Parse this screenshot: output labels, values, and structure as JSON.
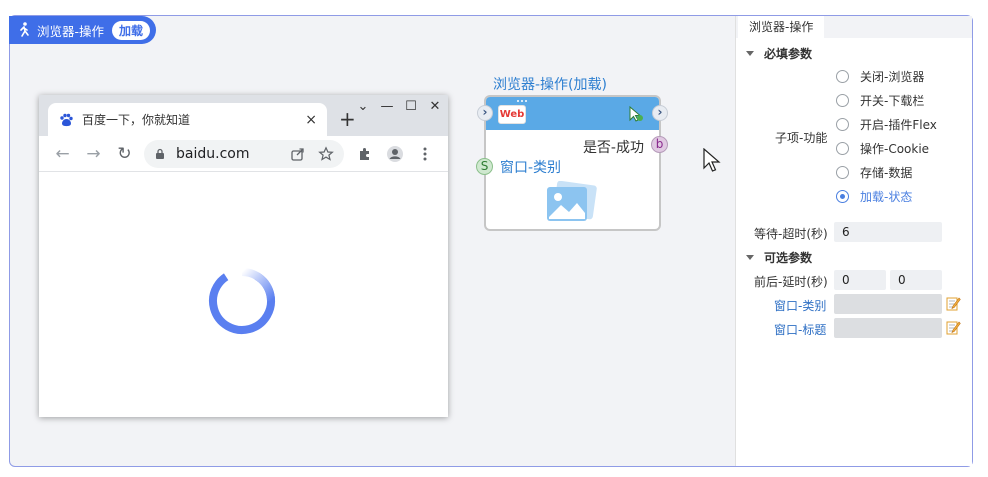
{
  "header": {
    "title": "浏览器-操作",
    "badge": "加载"
  },
  "browser": {
    "tab_title": "百度一下，你就知道",
    "tab_close": "×",
    "new_tab": "+",
    "url": "baidu.com",
    "win_controls": [
      "⌄",
      "—",
      "☐",
      "✕"
    ]
  },
  "node": {
    "title": "浏览器-操作(加载)",
    "web_icon_label": "Web",
    "output_label": "是否-成功",
    "output_port": "b",
    "input_port": "S",
    "input_label": "窗口-类别"
  },
  "panel": {
    "tab": "浏览器-操作",
    "required_section": "必填参数",
    "sub_function_label": "子项-功能",
    "options": [
      {
        "label": "关闭-浏览器",
        "selected": false
      },
      {
        "label": "开关-下载栏",
        "selected": false
      },
      {
        "label": "开启-插件Flex",
        "selected": false
      },
      {
        "label": "操作-Cookie",
        "selected": false
      },
      {
        "label": "存储-数据",
        "selected": false
      },
      {
        "label": "加载-状态",
        "selected": true
      }
    ],
    "timeout_label": "等待-超时(秒)",
    "timeout_value": "6",
    "optional_section": "可选参数",
    "delay_label": "前后-延时(秒)",
    "delay_before": "0",
    "delay_after": "0",
    "window_type_label": "窗口-类别",
    "window_title_label": "窗口-标题"
  },
  "colors": {
    "accent": "#3f6ee8",
    "node_head": "#5aa9e6",
    "link": "#2e6fc4"
  }
}
